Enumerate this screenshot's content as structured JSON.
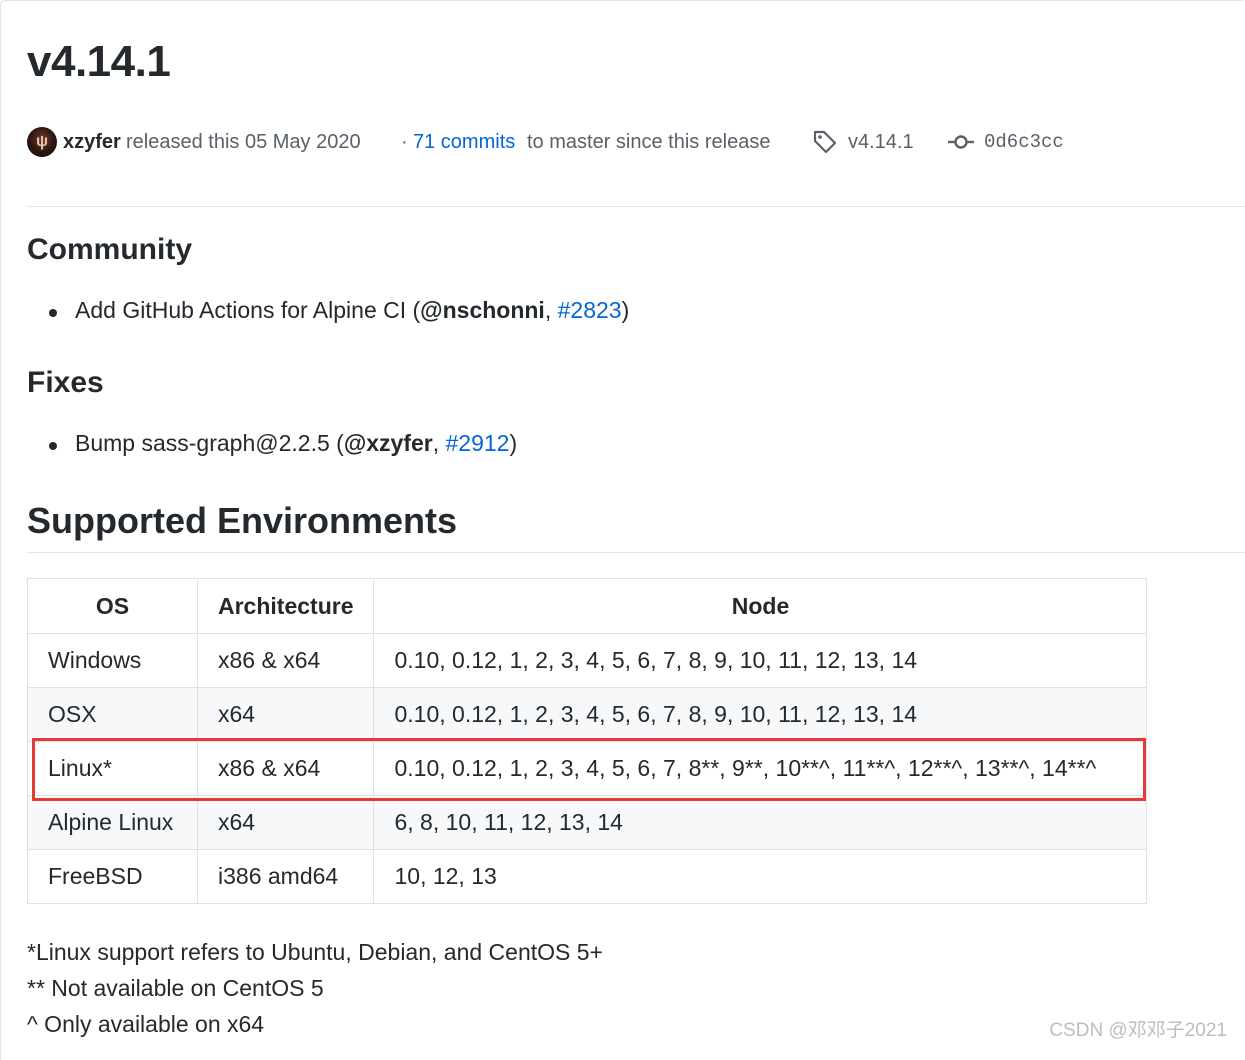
{
  "release": {
    "version_title": "v4.14.1",
    "author": "xzyfer",
    "released_text": "released this 05 May 2020",
    "separator": "·",
    "commits_link": "71 commits",
    "commits_suffix": "to master since this release",
    "tag": "v4.14.1",
    "commit_sha": "0d6c3cc"
  },
  "community": {
    "heading": "Community",
    "item": {
      "prefix": "Add GitHub Actions for Alpine CI (",
      "user": "@nschonni",
      "comma": ", ",
      "issue": "#2823",
      "suffix": ")"
    }
  },
  "fixes": {
    "heading": "Fixes",
    "item": {
      "prefix": "Bump sass-graph@2.2.5 (",
      "user": "@xzyfer",
      "comma": ", ",
      "issue": "#2912",
      "suffix": ")"
    }
  },
  "environments": {
    "heading": "Supported Environments",
    "headers": [
      "OS",
      "Architecture",
      "Node"
    ],
    "rows": [
      [
        "Windows",
        "x86 & x64",
        "0.10, 0.12, 1, 2, 3, 4, 5, 6, 7, 8, 9, 10, 11, 12, 13, 14"
      ],
      [
        "OSX",
        "x64",
        "0.10, 0.12, 1, 2, 3, 4, 5, 6, 7, 8, 9, 10, 11, 12, 13, 14"
      ],
      [
        "Linux*",
        "x86 & x64",
        "0.10, 0.12, 1, 2, 3, 4, 5, 6, 7, 8**, 9**, 10**^, 11**^, 12**^, 13**^, 14**^"
      ],
      [
        "Alpine Linux",
        "x64",
        "6, 8, 10, 11, 12, 13, 14"
      ],
      [
        "FreeBSD",
        "i386 amd64",
        "10, 12, 13"
      ]
    ],
    "highlight_color": "#e53935"
  },
  "notes": [
    "*Linux support refers to Ubuntu, Debian, and CentOS 5+",
    "** Not available on CentOS 5",
    "^ Only available on x64"
  ],
  "watermark": "CSDN @邓邓子2021",
  "colors": {
    "link": "#0366d6",
    "text": "#24292e",
    "muted": "#586069",
    "border": "#e1e4e8",
    "stripe": "#f6f8fa"
  }
}
